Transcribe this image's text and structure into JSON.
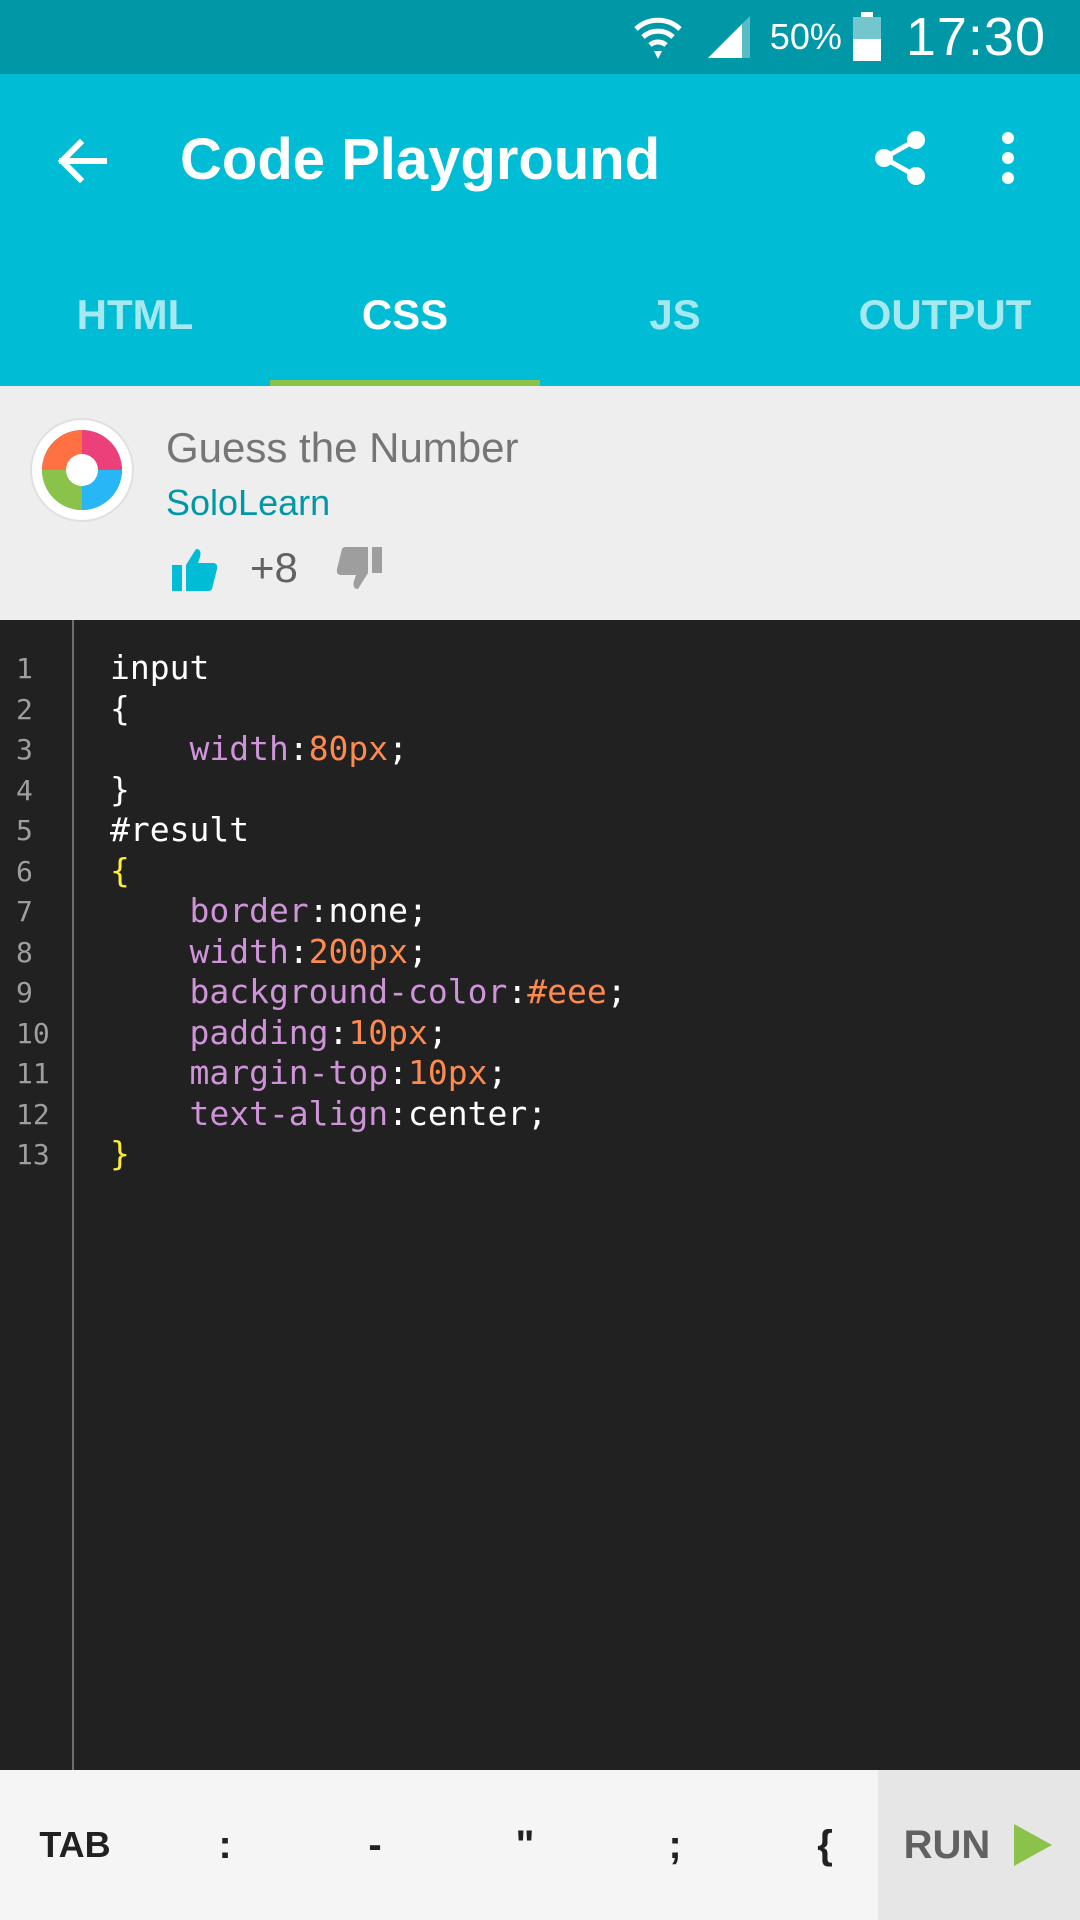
{
  "status_bar": {
    "battery_percent": "50%",
    "time": "17:30",
    "battery_level": 0.5
  },
  "toolbar": {
    "title": "Code Playground",
    "back_icon": "arrow-left-icon",
    "share_icon": "share-icon",
    "more_icon": "more-vert-icon"
  },
  "tabs": [
    {
      "label": "HTML",
      "active": false
    },
    {
      "label": "CSS",
      "active": true
    },
    {
      "label": "JS",
      "active": false
    },
    {
      "label": "OUTPUT",
      "active": false
    }
  ],
  "code_meta": {
    "title": "Guess the Number",
    "author": "SoloLearn",
    "votes": "+8"
  },
  "editor": {
    "line_numbers": [
      "1",
      "2",
      "3",
      "4",
      "5",
      "6",
      "7",
      "8",
      "9",
      "10",
      "11",
      "12",
      "13"
    ],
    "lines": [
      [
        {
          "t": "input",
          "c": "plain"
        }
      ],
      [
        {
          "t": "{",
          "c": "plain"
        }
      ],
      [
        {
          "t": "    width",
          "c": "prop"
        },
        {
          "t": ":",
          "c": "plain"
        },
        {
          "t": "80px",
          "c": "num"
        },
        {
          "t": ";",
          "c": "plain"
        }
      ],
      [
        {
          "t": "}",
          "c": "plain"
        }
      ],
      [
        {
          "t": "#result",
          "c": "plain"
        }
      ],
      [
        {
          "t": "{",
          "c": "brace"
        }
      ],
      [
        {
          "t": "    border",
          "c": "prop"
        },
        {
          "t": ":none;",
          "c": "plain"
        }
      ],
      [
        {
          "t": "    width",
          "c": "prop"
        },
        {
          "t": ":",
          "c": "plain"
        },
        {
          "t": "200px",
          "c": "num"
        },
        {
          "t": ";",
          "c": "plain"
        }
      ],
      [
        {
          "t": "    background-color",
          "c": "prop"
        },
        {
          "t": ":",
          "c": "plain"
        },
        {
          "t": "#eee",
          "c": "num"
        },
        {
          "t": ";",
          "c": "plain"
        }
      ],
      [
        {
          "t": "    padding",
          "c": "prop"
        },
        {
          "t": ":",
          "c": "plain"
        },
        {
          "t": "10px",
          "c": "num"
        },
        {
          "t": ";",
          "c": "plain"
        }
      ],
      [
        {
          "t": "    margin-top",
          "c": "prop"
        },
        {
          "t": ":",
          "c": "plain"
        },
        {
          "t": "10px",
          "c": "num"
        },
        {
          "t": ";",
          "c": "plain"
        }
      ],
      [
        {
          "t": "    text-align",
          "c": "prop"
        },
        {
          "t": ":center;",
          "c": "plain"
        }
      ],
      [
        {
          "t": "}",
          "c": "brace"
        }
      ]
    ]
  },
  "keybar": {
    "keys": [
      "TAB",
      ":",
      "-",
      "\"",
      ";",
      "{"
    ],
    "run_label": "RUN"
  },
  "colors": {
    "status_bar": "#0097a7",
    "app_bar": "#00bcd4",
    "tab_indicator": "#8bc34a",
    "author_link": "#0097a7",
    "run_icon": "#8bc34a"
  }
}
